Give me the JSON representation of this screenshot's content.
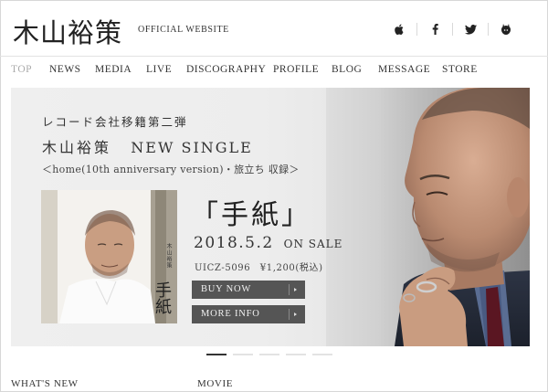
{
  "header": {
    "artist_name": "木山裕策",
    "site_label": "OFFICIAL WEBSITE",
    "social": [
      {
        "name": "apple-icon"
      },
      {
        "name": "facebook-icon"
      },
      {
        "name": "twitter-icon"
      },
      {
        "name": "fan-club-icon"
      }
    ]
  },
  "nav": {
    "items": [
      "TOP",
      "NEWS",
      "MEDIA",
      "LIVE",
      "DISCOGRAPHY",
      "PROFILE",
      "BLOG",
      "MESSAGE",
      "STORE"
    ],
    "active": "TOP"
  },
  "hero": {
    "label_line": "レコード会社移籍第二弾",
    "artist": "木山裕策",
    "single_label": "NEW SINGLE",
    "tracks": "＜home(10th anniversary version)・旅立ち 収録＞",
    "song_title": "「手紙」",
    "release_date": "2018.5.2",
    "release_suffix": "ON SALE",
    "catalog": "UICZ-5096　¥1,200(税込)",
    "buy_button": "BUY NOW",
    "info_button": "MORE INFO",
    "jacket_artist": "木山裕策",
    "jacket_title": "手紙"
  },
  "slider": {
    "count": 5,
    "active_index": 0
  },
  "sections": {
    "whats_new": "WHAT'S NEW",
    "movie": "MOVIE"
  },
  "colors": {
    "button_bg": "#555555",
    "active_nav": "#aaaaaa",
    "text": "#333333"
  }
}
